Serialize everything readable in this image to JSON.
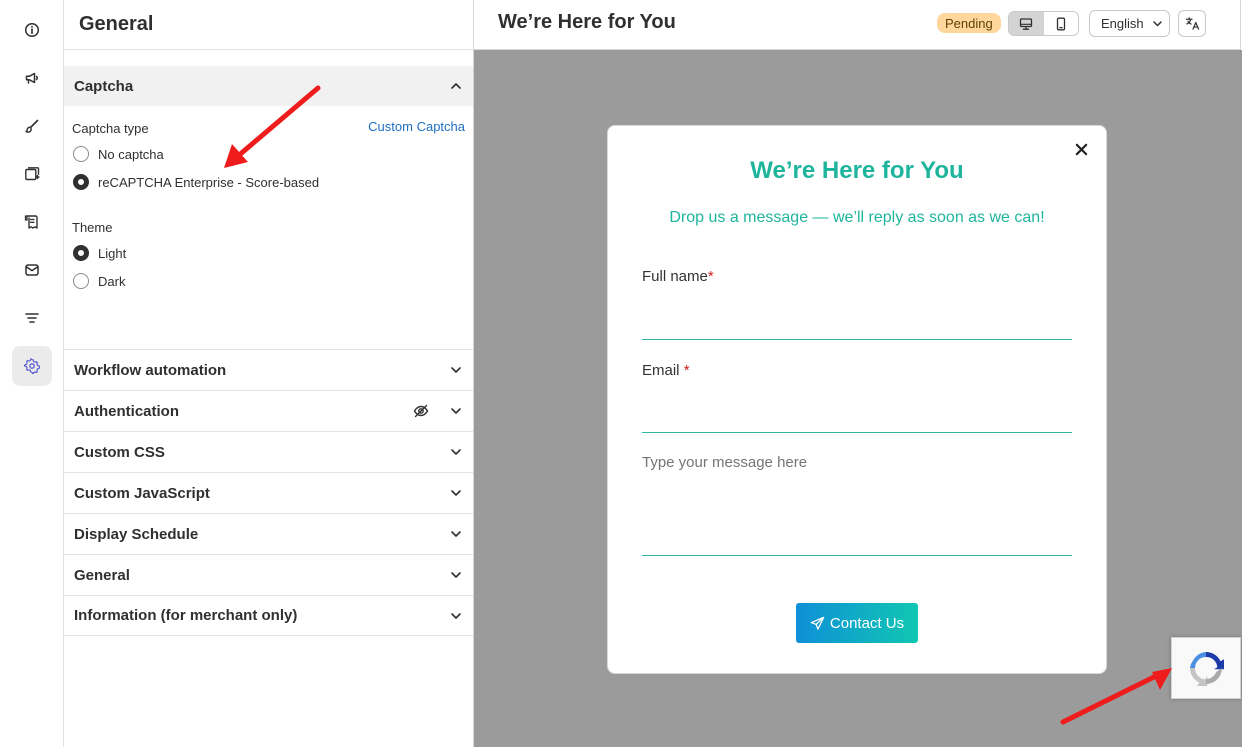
{
  "rail": {
    "items": [
      {
        "name": "info-icon"
      },
      {
        "name": "megaphone-icon"
      },
      {
        "name": "brush-icon"
      },
      {
        "name": "form-add-icon"
      },
      {
        "name": "receipt-icon"
      },
      {
        "name": "mail-icon"
      },
      {
        "name": "filter-icon"
      },
      {
        "name": "gear-icon",
        "active": true
      }
    ]
  },
  "panel": {
    "title": "General",
    "captcha": {
      "section_label": "Captcha",
      "type_label": "Captcha type",
      "custom_link": "Custom Captcha",
      "type_options": [
        {
          "label": "No captcha",
          "checked": false
        },
        {
          "label": "reCAPTCHA Enterprise - Score-based",
          "checked": true
        }
      ],
      "theme_label": "Theme",
      "theme_options": [
        {
          "label": "Light",
          "checked": true
        },
        {
          "label": "Dark",
          "checked": false
        }
      ]
    },
    "sections": [
      "Workflow automation",
      "Authentication",
      "Custom CSS",
      "Custom JavaScript",
      "Display Schedule",
      "General",
      "Information (for merchant only)"
    ]
  },
  "preview": {
    "title": "We’re Here for You",
    "status": "Pending",
    "language": "English",
    "form": {
      "heading": "We’re Here for You",
      "subheading": "Drop us a message — we’ll reply as soon as we can!",
      "full_name_label": "Full name",
      "email_label": "Email ",
      "required_mark": "*",
      "message_placeholder": "Type your message here",
      "submit_label": "Contact Us"
    }
  },
  "colors": {
    "accent_teal": "#1fb59d",
    "link_blue": "#1f6fc5",
    "badge_bg": "#ffd79d",
    "canvas_gray": "#9b9b9b",
    "arrow_red": "#ee1c1c"
  }
}
